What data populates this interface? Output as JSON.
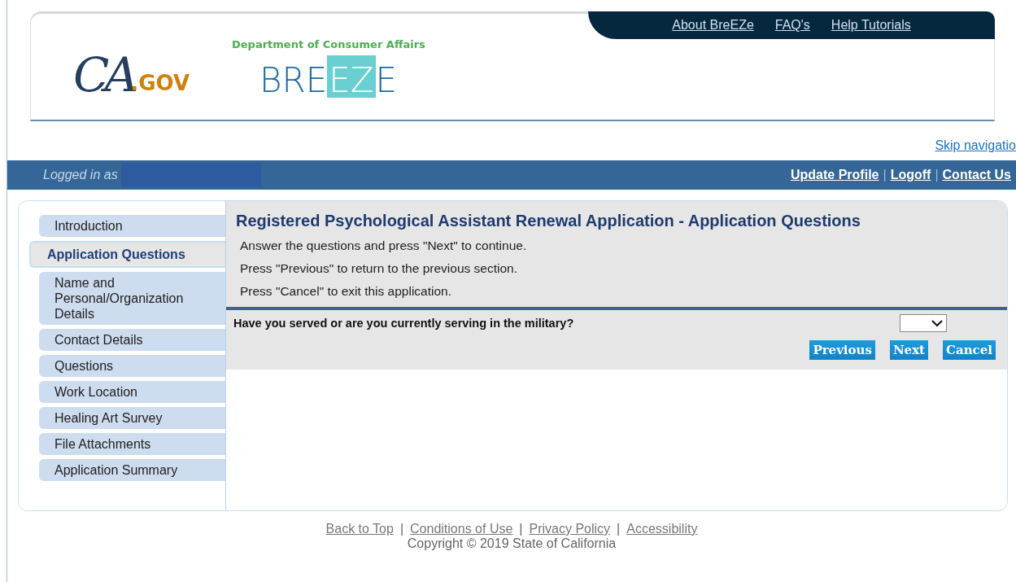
{
  "header": {
    "ca_logo": {
      "script": "CA",
      "suffix": ".GOV"
    },
    "department": "Department of Consumer Affairs",
    "breeze_logo": {
      "before": "BRE",
      "highlight": "EZ",
      "after": "E"
    },
    "top_links": [
      "About BreEZe",
      "FAQ's",
      "Help Tutorials"
    ]
  },
  "skip_link": "Skip navigatio",
  "user_bar": {
    "logged_in_label": "Logged in as",
    "links": [
      "Update Profile",
      "Logoff",
      "Contact Us"
    ],
    "separator": "|"
  },
  "sidebar": {
    "items": [
      {
        "label": "Introduction",
        "selected": false
      },
      {
        "label": "Application Questions",
        "selected": true
      },
      {
        "label": "Name and Personal/Organization Details",
        "selected": false
      },
      {
        "label": "Contact Details",
        "selected": false
      },
      {
        "label": "Questions",
        "selected": false
      },
      {
        "label": "Work Location",
        "selected": false
      },
      {
        "label": "Healing Art Survey",
        "selected": false
      },
      {
        "label": "File Attachments",
        "selected": false
      },
      {
        "label": "Application Summary",
        "selected": false
      }
    ]
  },
  "content": {
    "title": "Registered Psychological Assistant Renewal Application - Application Questions",
    "instructions": [
      "Answer the questions and press \"Next\" to continue.",
      "Press \"Previous\" to return to the previous section.",
      "Press \"Cancel\" to exit this application."
    ],
    "question": "Have you served or are you currently serving in the military?",
    "buttons": [
      "Previous",
      "Next",
      "Cancel"
    ]
  },
  "footer": {
    "links": [
      "Back to Top",
      "Conditions of Use",
      "Privacy Policy",
      "Accessibility"
    ],
    "separator": "|",
    "copyright": "Copyright © 2019 State of California"
  }
}
